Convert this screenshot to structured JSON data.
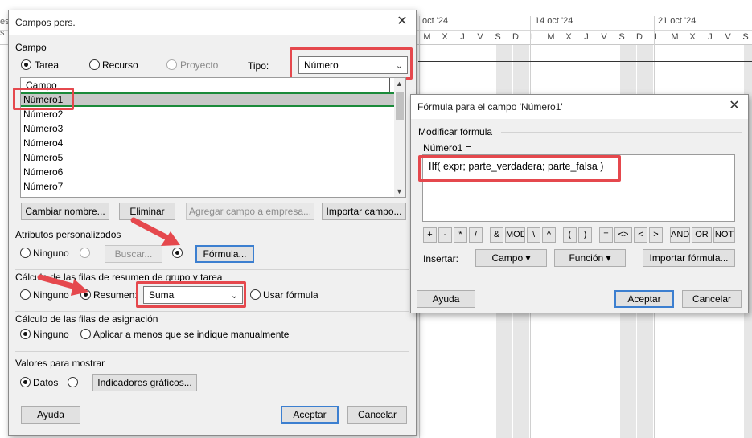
{
  "gantt": {
    "weeks": [
      "oct '24",
      "14 oct '24",
      "21 oct '24"
    ],
    "days": [
      "M",
      "X",
      "J",
      "V",
      "S",
      "D",
      "L",
      "M",
      "X",
      "J",
      "V",
      "S",
      "D",
      "L",
      "M",
      "X",
      "J",
      "V",
      "S"
    ],
    "left_edge": [
      "es",
      "s"
    ]
  },
  "custom_fields": {
    "title": "Campos pers.",
    "close": "✕",
    "field_group": "Campo",
    "radio_task": "Tarea",
    "radio_resource": "Recurso",
    "radio_project": "Proyecto",
    "type_label": "Tipo:",
    "type_value": "Número",
    "list_header": "Campo",
    "list_items": [
      "Número1",
      "Número2",
      "Número3",
      "Número4",
      "Número5",
      "Número6",
      "Número7"
    ],
    "btn_rename": "Cambiar nombre...",
    "btn_delete": "Eliminar",
    "btn_add_enterprise": "Agregar campo a empresa...",
    "btn_import_field": "Importar campo...",
    "attrs_group": "Atributos personalizados",
    "attrs_none": "Ninguno",
    "btn_lookup": "Buscar...",
    "btn_formula": "Fórmula...",
    "summary_group": "Cálculo de las filas de resumen de grupo y tarea",
    "summary_none": "Ninguno",
    "summary_rollup": "Resumen:",
    "summary_value": "Suma",
    "summary_use_formula": "Usar fórmula",
    "assign_group": "Cálculo de las filas de asignación",
    "assign_none": "Ninguno",
    "assign_rollup": "Aplicar a menos que se indique manualmente",
    "display_group": "Valores para mostrar",
    "display_data": "Datos",
    "btn_indicators": "Indicadores gráficos...",
    "btn_help": "Ayuda",
    "btn_ok": "Aceptar",
    "btn_cancel": "Cancelar"
  },
  "formula_dialog": {
    "title": "Fórmula para el campo 'Número1'",
    "close": "✕",
    "group": "Modificar fórmula",
    "field_eq": "Número1 =",
    "formula_text": "IIf( expr; parte_verdadera; parte_falsa )",
    "operators": [
      "+",
      "-",
      "*",
      "/",
      "&",
      "MOD",
      "\\",
      "^",
      "(",
      ")",
      "=",
      "<>",
      "<",
      ">",
      "AND",
      "OR",
      "NOT"
    ],
    "insert_label": "Insertar:",
    "btn_field": "Campo ▾",
    "btn_function": "Función ▾",
    "btn_import_formula": "Importar fórmula...",
    "btn_help": "Ayuda",
    "btn_ok": "Aceptar",
    "btn_cancel": "Cancelar"
  },
  "colors": {
    "highlight_red": "#e5484d",
    "selection_green": "#1a8a3a",
    "default_button_blue": "#3c7fd0"
  }
}
